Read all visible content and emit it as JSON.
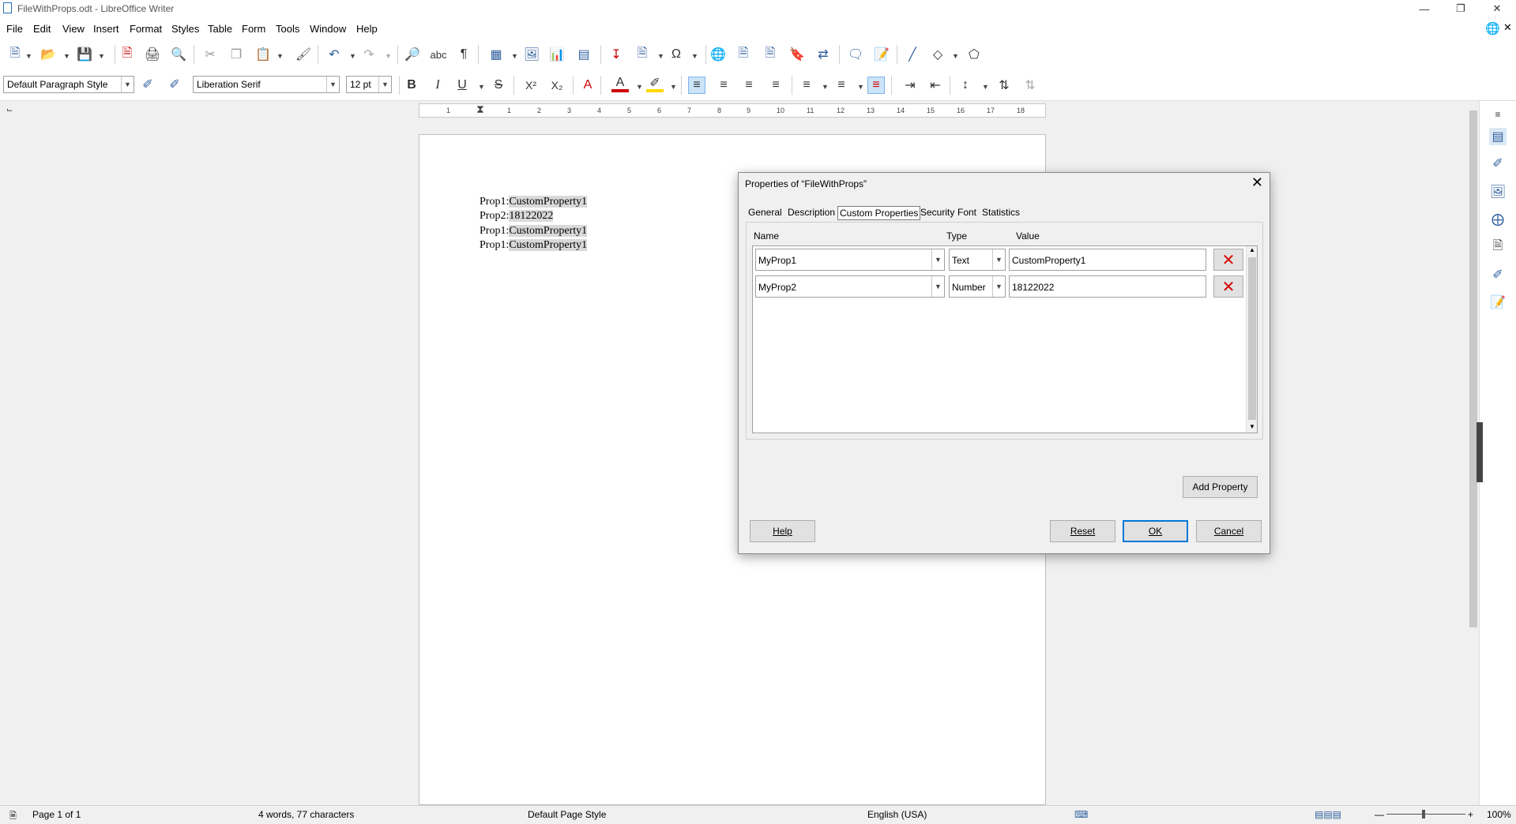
{
  "window": {
    "title": "FileWithProps.odt - LibreOffice Writer"
  },
  "menu": [
    "File",
    "Edit",
    "View",
    "Insert",
    "Format",
    "Styles",
    "Table",
    "Form",
    "Tools",
    "Window",
    "Help"
  ],
  "format_toolbar": {
    "paragraph_style": "Default Paragraph Style",
    "font_name": "Liberation Serif",
    "font_size": "12 pt"
  },
  "document": {
    "lines": [
      {
        "label": "Prop1:",
        "value": "CustomProperty1",
        "highlight": true
      },
      {
        "label": "Prop2:",
        "value": "18122022",
        "highlight": true
      },
      {
        "label": "Prop1:",
        "value": "CustomProperty1",
        "highlight": true
      },
      {
        "label": "Prop1:",
        "value": "CustomProperty1",
        "highlight": true
      }
    ]
  },
  "ruler": [
    "1",
    "1",
    "2",
    "3",
    "4",
    "5",
    "6",
    "7",
    "8",
    "9",
    "10",
    "11",
    "12",
    "13",
    "14",
    "15",
    "16",
    "17",
    "18"
  ],
  "dialog": {
    "title": "Properties of “FileWithProps”",
    "tabs": [
      "General",
      "Description",
      "Custom Properties",
      "Security",
      "Font",
      "Statistics"
    ],
    "active_tab": "Custom Properties",
    "headers": {
      "name": "Name",
      "type": "Type",
      "value": "Value"
    },
    "properties": [
      {
        "name": "MyProp1",
        "type": "Text",
        "value": "CustomProperty1"
      },
      {
        "name": "MyProp2",
        "type": "Number",
        "value": "18122022"
      }
    ],
    "add_property_label": "Add Property",
    "buttons": {
      "help": "Help",
      "reset": "Reset",
      "ok": "OK",
      "cancel": "Cancel"
    }
  },
  "statusbar": {
    "page": "Page 1 of 1",
    "words": "4 words, 77 characters",
    "page_style": "Default Page Style",
    "language": "English (USA)",
    "zoom": "100%"
  },
  "colors": {
    "accent": "#2f5f9e",
    "delete": "#d60000",
    "highlight": "#d9d9d9"
  }
}
